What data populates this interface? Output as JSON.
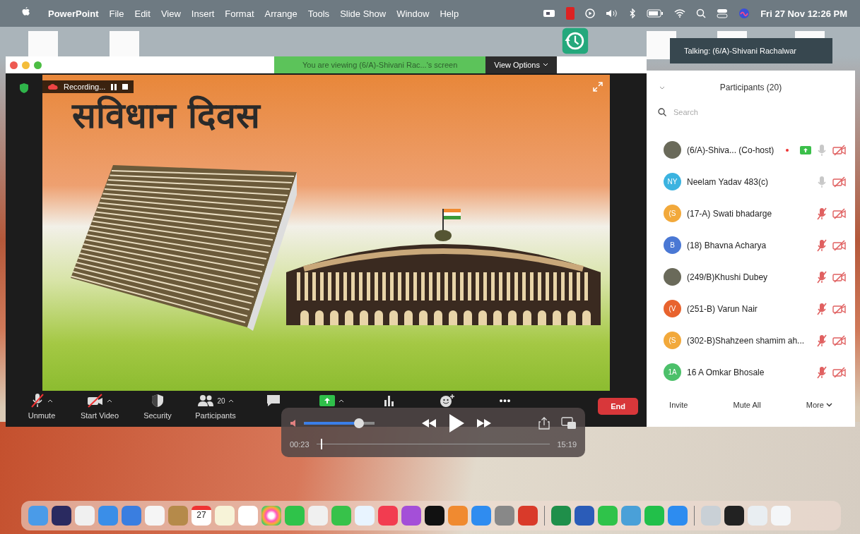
{
  "menubar": {
    "app": "PowerPoint",
    "menus": [
      "File",
      "Edit",
      "View",
      "Insert",
      "Format",
      "Arrange",
      "Tools",
      "Slide Show",
      "Window",
      "Help"
    ],
    "clock": "Fri 27 Nov  12:26 PM"
  },
  "meeting": {
    "banner": "You are viewing (6/A)-Shivani Rac...'s screen",
    "view_options": "View Options",
    "recording": "Recording...",
    "talking": "Talking: (6/A)-Shivani Rachalwar"
  },
  "slide": {
    "title": "सविधान दिवस"
  },
  "toolbar": [
    {
      "kind": "mic",
      "label": "Unmute",
      "off": true,
      "caret": true
    },
    {
      "kind": "video",
      "label": "Start Video",
      "off": true,
      "caret": true
    },
    {
      "kind": "security",
      "label": "Security",
      "caret": false
    },
    {
      "kind": "participants",
      "label": "Participants",
      "count": "20",
      "caret": true
    },
    {
      "kind": "chat",
      "caret": false
    },
    {
      "kind": "share",
      "caret": true
    },
    {
      "kind": "polls",
      "caret": false
    },
    {
      "kind": "reactions",
      "caret": false
    },
    {
      "kind": "more",
      "glyph": "•••",
      "caret": false
    }
  ],
  "end_button": "End",
  "participants": {
    "title": "Participants (20)",
    "search_placeholder": "Search",
    "people": [
      {
        "name": "(6/A)-Shiva... (Co-host)",
        "kind": "photo",
        "muted": false,
        "sharing": true
      },
      {
        "name": "Neelam Yadav 483(c)",
        "kind": "initials",
        "initials": "NY",
        "color": "#3bb3e0",
        "muted": false,
        "sharing": false
      },
      {
        "name": "(17-A) Swati bhadarge",
        "kind": "initials",
        "initials": "(S",
        "color": "#f2a93b",
        "muted": true,
        "sharing": false
      },
      {
        "name": "(18) Bhavna Acharya",
        "kind": "initials",
        "initials": "B",
        "color": "#4a78d4",
        "muted": true,
        "sharing": false
      },
      {
        "name": "(249/B)Khushi Dubey",
        "kind": "photo",
        "muted": true,
        "sharing": false
      },
      {
        "name": "(251-B) Varun Nair",
        "kind": "initials",
        "initials": "(V",
        "color": "#e8632e",
        "muted": true,
        "sharing": false
      },
      {
        "name": "(302-B)Shahzeen shamim ah...",
        "kind": "initials",
        "initials": "(S",
        "color": "#f2a93b",
        "muted": true,
        "sharing": false
      },
      {
        "name": "16 A Omkar Bhosale",
        "kind": "initials",
        "initials": "1A",
        "color": "#4cc06a",
        "muted": true,
        "sharing": false
      }
    ],
    "footer": [
      "Invite",
      "Mute All",
      "More"
    ]
  },
  "player": {
    "volume": {
      "level": 0.78
    },
    "progress": {
      "level": 0.02
    },
    "elapsed": "00:23",
    "total": "15:19"
  },
  "dock": {
    "calendar_day": "27"
  }
}
